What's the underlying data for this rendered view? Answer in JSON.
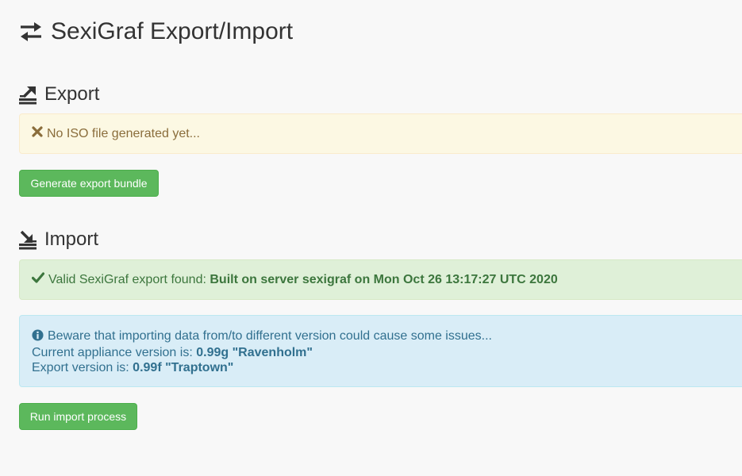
{
  "header": {
    "title": "SexiGraf Export/Import",
    "icon": "exchange-arrows-icon"
  },
  "export": {
    "title": "Export",
    "icon": "export-icon",
    "alert": {
      "icon": "times-icon",
      "text": "No ISO file generated yet..."
    },
    "button_label": "Generate export bundle"
  },
  "import": {
    "title": "Import",
    "icon": "import-icon",
    "success_alert": {
      "icon": "check-icon",
      "prefix": "Valid SexiGraf export found:",
      "detail": "Built on server sexigraf on Mon Oct 26 13:17:27 UTC 2020"
    },
    "info_alert": {
      "icon": "info-circle-icon",
      "warning_text": "Beware that importing data from/to different version could cause some issues...",
      "current_label": "Current appliance version is:",
      "current_value": "0.99g \"Ravenholm\"",
      "export_label": "Export version is:",
      "export_value": "0.99f \"Traptown\""
    },
    "button_label": "Run import process"
  },
  "colors": {
    "background": "#f8f8f8",
    "warning_bg": "#fcf8e3",
    "warning_text": "#8a6d3b",
    "success_bg": "#dff0d8",
    "success_text": "#3c763d",
    "info_bg": "#d9edf7",
    "info_text": "#31708f",
    "button_green": "#5cb85c"
  }
}
